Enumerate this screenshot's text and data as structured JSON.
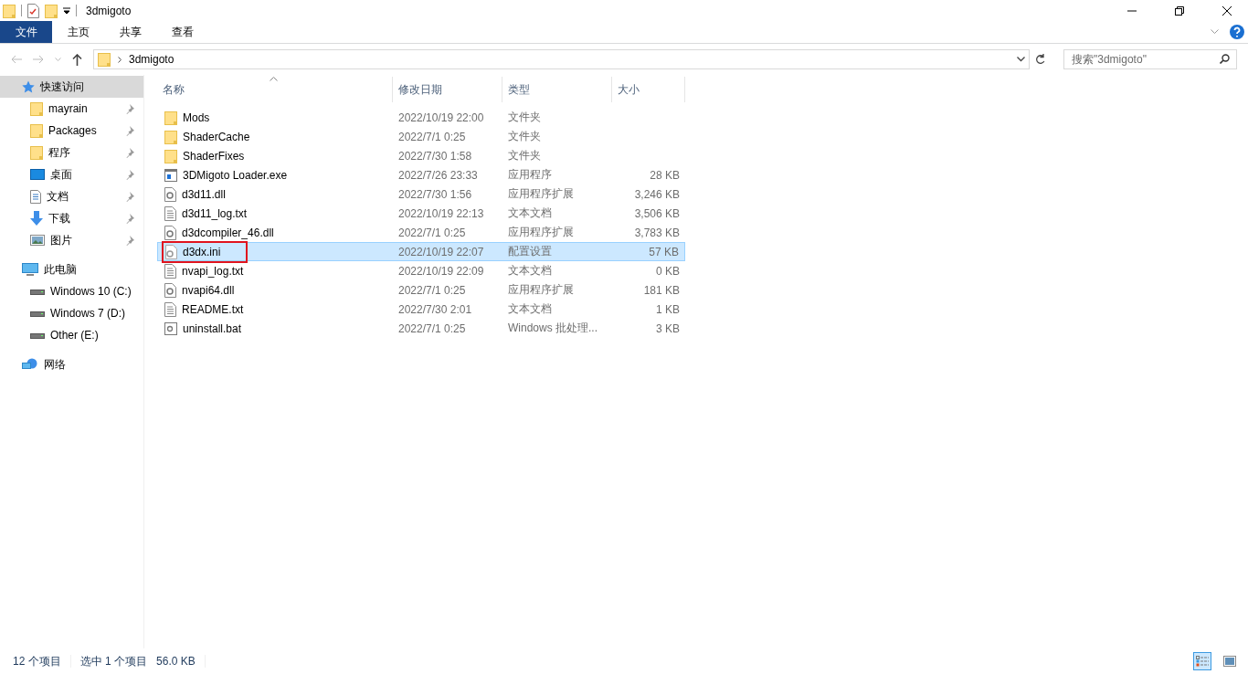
{
  "window": {
    "title": "3dmigoto"
  },
  "ribbon_tabs": [
    {
      "label": "文件",
      "selected": true
    },
    {
      "label": "主页",
      "selected": false
    },
    {
      "label": "共享",
      "selected": false
    },
    {
      "label": "查看",
      "selected": false
    }
  ],
  "address": {
    "path": "3dmigoto"
  },
  "search": {
    "placeholder": "搜索\"3dmigoto\""
  },
  "sidebar": {
    "sections": [
      {
        "label": "快速访问",
        "kind": "star",
        "selected": true,
        "children": [
          {
            "label": "mayrain",
            "kind": "folder",
            "pinned": true
          },
          {
            "label": "Packages",
            "kind": "folder",
            "pinned": true
          },
          {
            "label": "程序",
            "kind": "folder",
            "pinned": true
          },
          {
            "label": "桌面",
            "kind": "desktop",
            "pinned": true
          },
          {
            "label": "文档",
            "kind": "document",
            "pinned": true
          },
          {
            "label": "下载",
            "kind": "download",
            "pinned": true
          },
          {
            "label": "图片",
            "kind": "picture",
            "pinned": true
          }
        ]
      },
      {
        "label": "此电脑",
        "kind": "computer",
        "selected": false,
        "children": [
          {
            "label": "Windows 10 (C:)",
            "kind": "drive",
            "pinned": false
          },
          {
            "label": "Windows 7 (D:)",
            "kind": "drive",
            "pinned": false
          },
          {
            "label": "Other (E:)",
            "kind": "drive",
            "pinned": false
          }
        ]
      },
      {
        "label": "网络",
        "kind": "network",
        "selected": false
      }
    ]
  },
  "table": {
    "columns": [
      "名称",
      "修改日期",
      "类型",
      "大小"
    ],
    "rows": [
      {
        "name": "Mods",
        "kind": "folder",
        "modified": "2022/10/19 22:00",
        "type": "文件夹",
        "size": "",
        "selected": false,
        "outlined": false
      },
      {
        "name": "ShaderCache",
        "kind": "folder",
        "modified": "2022/7/1 0:25",
        "type": "文件夹",
        "size": "",
        "selected": false,
        "outlined": false
      },
      {
        "name": "ShaderFixes",
        "kind": "folder",
        "modified": "2022/7/30 1:58",
        "type": "文件夹",
        "size": "",
        "selected": false,
        "outlined": false
      },
      {
        "name": "3DMigoto Loader.exe",
        "kind": "exe",
        "modified": "2022/7/26 23:33",
        "type": "应用程序",
        "size": "28 KB",
        "selected": false,
        "outlined": false
      },
      {
        "name": "d3d11.dll",
        "kind": "dll",
        "modified": "2022/7/30 1:56",
        "type": "应用程序扩展",
        "size": "3,246 KB",
        "selected": false,
        "outlined": false
      },
      {
        "name": "d3d11_log.txt",
        "kind": "text",
        "modified": "2022/10/19 22:13",
        "type": "文本文档",
        "size": "3,506 KB",
        "selected": false,
        "outlined": false
      },
      {
        "name": "d3dcompiler_46.dll",
        "kind": "dll",
        "modified": "2022/7/1 0:25",
        "type": "应用程序扩展",
        "size": "3,783 KB",
        "selected": false,
        "outlined": false
      },
      {
        "name": "d3dx.ini",
        "kind": "ini",
        "modified": "2022/10/19 22:07",
        "type": "配置设置",
        "size": "57 KB",
        "selected": true,
        "outlined": true
      },
      {
        "name": "nvapi_log.txt",
        "kind": "text",
        "modified": "2022/10/19 22:09",
        "type": "文本文档",
        "size": "0 KB",
        "selected": false,
        "outlined": false
      },
      {
        "name": "nvapi64.dll",
        "kind": "dll",
        "modified": "2022/7/1 0:25",
        "type": "应用程序扩展",
        "size": "181 KB",
        "selected": false,
        "outlined": false
      },
      {
        "name": "README.txt",
        "kind": "text",
        "modified": "2022/7/30 2:01",
        "type": "文本文档",
        "size": "1 KB",
        "selected": false,
        "outlined": false
      },
      {
        "name": "uninstall.bat",
        "kind": "bat",
        "modified": "2022/7/1 0:25",
        "type": "Windows 批处理...",
        "size": "3 KB",
        "selected": false,
        "outlined": false
      }
    ]
  },
  "status_bar": {
    "item_count": "12 个项目",
    "selection": "选中 1 个项目",
    "selection_size": "56.0 KB"
  }
}
